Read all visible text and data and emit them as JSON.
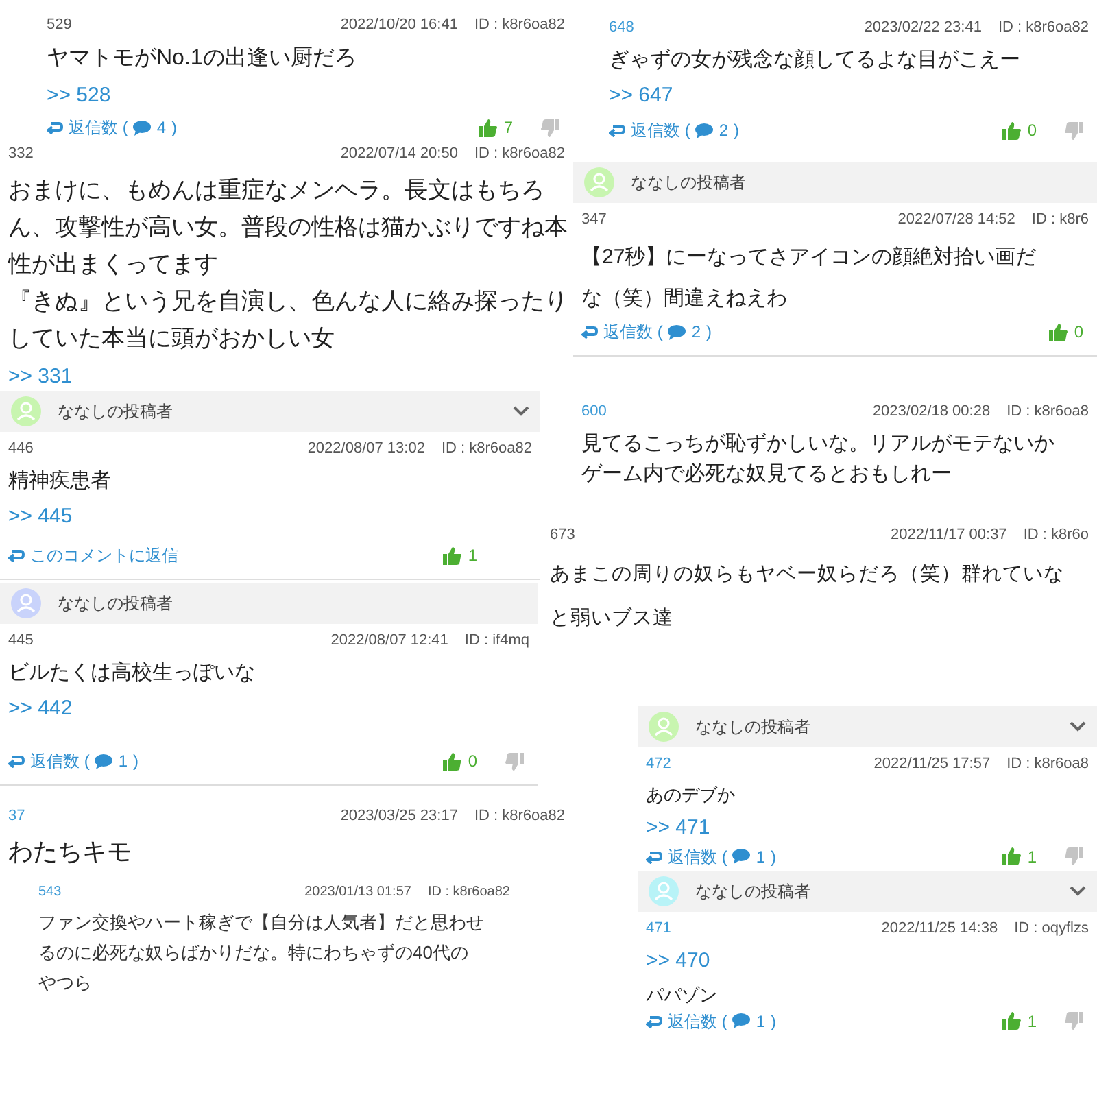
{
  "snippets": [
    {
      "number": "529",
      "linked": false,
      "date": "2022/10/20 16:41",
      "id": "ID : k8r6oa82",
      "content": [
        {
          "kind": "text",
          "lines": [
            "ヤマトモがNo.1の出逢い厨だろ"
          ]
        },
        {
          "kind": "ref",
          "text": ">> 528"
        }
      ],
      "reply": {
        "label": "返信数 (",
        "count": "4",
        "close": ")"
      },
      "likes": "7",
      "dislike": true
    },
    {
      "number": "332",
      "linked": false,
      "date": "2022/07/14 20:50",
      "id": "ID : k8r6oa82",
      "content": [
        {
          "kind": "text",
          "lines": [
            "おまけに、もめんは重症なメンヘラ。長文はもちろ",
            "ん、攻撃性が高い女。普段の性格は猫かぶりですね本",
            "性が出まくってます",
            "『きぬ』という兄を自演し、色んな人に絡み探ったり",
            "していた本当に頭がおかしい女"
          ]
        },
        {
          "kind": "ref",
          "text": ">> 331"
        }
      ]
    },
    {
      "header": {
        "name": "ななしの投稿者",
        "color": "#c8f5b0",
        "chevron": true
      },
      "number": "446",
      "linked": false,
      "date": "2022/08/07 13:02",
      "id": "ID : k8r6oa82",
      "content": [
        {
          "kind": "text",
          "lines": [
            "精神疾患者"
          ]
        },
        {
          "kind": "ref",
          "text": ">> 445"
        }
      ],
      "reply": {
        "label": "このコメントに返信"
      },
      "likes": "1"
    },
    {
      "header": {
        "name": "ななしの投稿者",
        "color": "#c9d3fb"
      },
      "number": "445",
      "linked": false,
      "date": "2022/08/07 12:41",
      "id": "ID : if4mq",
      "content": [
        {
          "kind": "text",
          "lines": [
            "ビルたくは高校生っぽいな"
          ]
        },
        {
          "kind": "ref",
          "text": ">> 442"
        }
      ],
      "reply": {
        "label": "返信数 (",
        "count": "1",
        "close": ")"
      },
      "likes": "0",
      "dislike": true
    },
    {
      "number": "37",
      "linked": true,
      "date": "2023/03/25 23:17",
      "id": "ID : k8r6oa82",
      "content": [
        {
          "kind": "text",
          "lines": [
            "わたちキモ"
          ]
        }
      ],
      "nested": {
        "number": "543",
        "linked": true,
        "date": "2023/01/13 01:57",
        "id": "ID : k8r6oa82",
        "lines": [
          "ファン交換やハート稼ぎで【自分は人気者】だと思わせ",
          "るのに必死な奴らばかりだな。特にわちゃずの40代の",
          "やつら"
        ]
      }
    },
    {
      "number": "648",
      "linked": true,
      "date": "2023/02/22 23:41",
      "id": "ID : k8r6oa82",
      "content": [
        {
          "kind": "text",
          "lines": [
            "ぎゃずの女が残念な顔してるよな目がこえー"
          ]
        },
        {
          "kind": "ref",
          "text": ">> 647"
        }
      ],
      "reply": {
        "label": "返信数 (",
        "count": "2",
        "close": ")"
      },
      "likes": "0",
      "dislike": true
    },
    {
      "header": {
        "name": "ななしの投稿者",
        "color": "#c8f5b0"
      },
      "number": "347",
      "linked": false,
      "date": "2022/07/28 14:52",
      "id": "ID : k8r6",
      "content": [
        {
          "kind": "text",
          "lines": [
            "【27秒】にーなってさアイコンの顔絶対拾い画だ",
            "な（笑）間違えねえわ"
          ]
        }
      ],
      "reply": {
        "label": "返信数 (",
        "count": "2",
        "close": ")"
      },
      "likes": "0"
    },
    {
      "number": "600",
      "linked": true,
      "date": "2023/02/18 00:28",
      "id": "ID : k8r6oa8",
      "content": [
        {
          "kind": "text",
          "lines": [
            "見てるこっちが恥ずかしいな。リアルがモテないか",
            "ゲーム内で必死な奴見てるとおもしれー"
          ]
        }
      ]
    },
    {
      "number": "673",
      "linked": false,
      "date": "2022/11/17 00:37",
      "id": "ID : k8r6o",
      "content": [
        {
          "kind": "text",
          "lines": [
            "あまこの周りの奴らもヤベー奴らだろ（笑）群れていな",
            "と弱いブス達"
          ]
        }
      ]
    },
    {
      "header": {
        "name": "ななしの投稿者",
        "color": "#c8f5b0",
        "chevron": true
      },
      "number": "472",
      "linked": true,
      "date": "2022/11/25 17:57",
      "id": "ID : k8r6oa8",
      "content": [
        {
          "kind": "text",
          "lines": [
            "あのデブか"
          ]
        },
        {
          "kind": "ref",
          "text": ">> 471"
        }
      ],
      "reply": {
        "label": "返信数 (",
        "count": "1",
        "close": ")"
      },
      "likes": "1",
      "dislike": true
    },
    {
      "header": {
        "name": "ななしの投稿者",
        "color": "#b8f3f7",
        "chevron": true
      },
      "number": "471",
      "linked": true,
      "date": "2022/11/25 14:38",
      "id": "ID : oqyflzs",
      "content": [
        {
          "kind": "ref",
          "text": ">> 470"
        },
        {
          "kind": "text",
          "lines": [
            "パパゾン"
          ]
        }
      ],
      "reply": {
        "label": "返信数 (",
        "count": "1",
        "close": ")"
      },
      "likes": "1",
      "dislike": true
    }
  ]
}
